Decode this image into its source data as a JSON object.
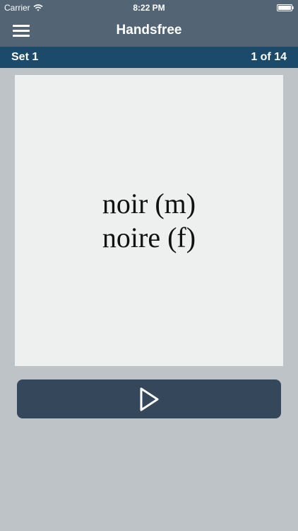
{
  "status_bar": {
    "carrier": "Carrier",
    "time": "8:22 PM",
    "wifi_icon": "wifi-icon",
    "battery_icon": "battery-icon"
  },
  "nav_bar": {
    "menu_icon": "hamburger-menu-icon",
    "title": "Handsfree"
  },
  "set_bar": {
    "set_label": "Set 1",
    "progress": "1 of 14"
  },
  "card": {
    "line1": "noir (m)",
    "line2": "noire (f)"
  },
  "controls": {
    "play_icon": "play-icon"
  },
  "colors": {
    "nav_background": "#536474",
    "set_bar_background": "#1b4a6a",
    "page_background": "#bec3c7",
    "card_background": "#eef0f0",
    "play_button": "#34475b"
  }
}
